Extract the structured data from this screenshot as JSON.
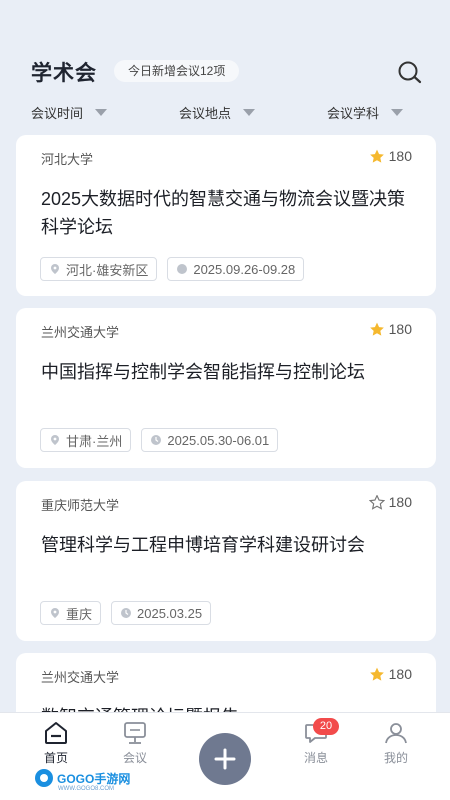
{
  "header": {
    "title": "学术会",
    "badge": "今日新增会议12项"
  },
  "filters": [
    {
      "label": "会议时间"
    },
    {
      "label": "会议地点"
    },
    {
      "label": "会议学科"
    }
  ],
  "cards": [
    {
      "university": "河北大学",
      "favorites": "180",
      "favorited": true,
      "title": "2025大数据时代的智慧交通与物流会议暨决策科学论坛",
      "location": "河北·雄安新区",
      "date": "2025.09.26-09.28"
    },
    {
      "university": "兰州交通大学",
      "favorites": "180",
      "favorited": true,
      "title": "中国指挥与控制学会智能指挥与控制论坛",
      "location": "甘肃·兰州",
      "date": "2025.05.30-06.01"
    },
    {
      "university": "重庆师范大学",
      "favorites": "180",
      "favorited": false,
      "title": "管理科学与工程申博培育学科建设研讨会",
      "location": "重庆",
      "date": "2025.03.25"
    },
    {
      "university": "兰州交通大学",
      "favorites": "180",
      "favorited": true,
      "title": "数智交通管理论坛暨报告",
      "location": "",
      "date": ""
    }
  ],
  "nav": {
    "home": "首页",
    "meeting": "会议",
    "messages": "消息",
    "messages_count": "20",
    "mine": "我的"
  },
  "watermark": {
    "brand": "GOGO手游网",
    "url": "WWW.GOGO8.COM"
  },
  "colors": {
    "background": "#e9eef6",
    "star_active": "#f5b82e",
    "badge_red": "#f24b4b",
    "add_button": "#6f7990"
  }
}
